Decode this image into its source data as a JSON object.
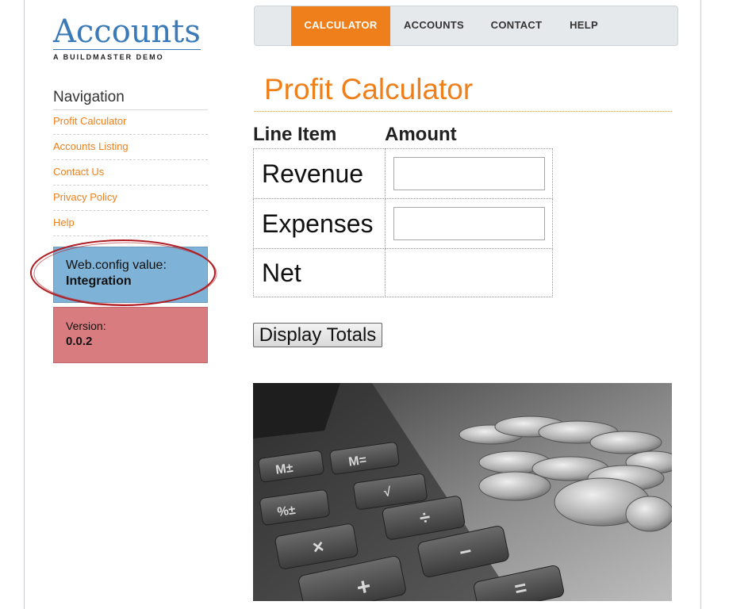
{
  "logo": {
    "title": "Accounts",
    "subtitle": "A BUILDMASTER DEMO"
  },
  "topnav": {
    "items": [
      {
        "label": "CALCULATOR",
        "active": true
      },
      {
        "label": "ACCOUNTS",
        "active": false
      },
      {
        "label": "CONTACT",
        "active": false
      },
      {
        "label": "HELP",
        "active": false
      }
    ]
  },
  "sidebar": {
    "heading": "Navigation",
    "items": [
      {
        "label": "Profit Calculator"
      },
      {
        "label": "Accounts Listing"
      },
      {
        "label": "Contact Us"
      },
      {
        "label": "Privacy Policy"
      },
      {
        "label": "Help"
      }
    ],
    "config_box": {
      "label": "Web.config value:",
      "value": "Integration"
    },
    "version_box": {
      "label": "Version:",
      "value": "0.0.2"
    }
  },
  "main": {
    "title": "Profit Calculator",
    "columns": {
      "line_item": "Line Item",
      "amount": "Amount"
    },
    "rows": [
      {
        "label": "Revenue",
        "value": ""
      },
      {
        "label": "Expenses",
        "value": ""
      },
      {
        "label": "Net",
        "value": ""
      }
    ],
    "button_label": "Display Totals"
  },
  "colors": {
    "accent": "#ef7f1a",
    "logo_blue": "#3a7ab8",
    "config_box": "#7fb2d7",
    "version_box": "#d97c80",
    "annotation": "#b01e24"
  }
}
